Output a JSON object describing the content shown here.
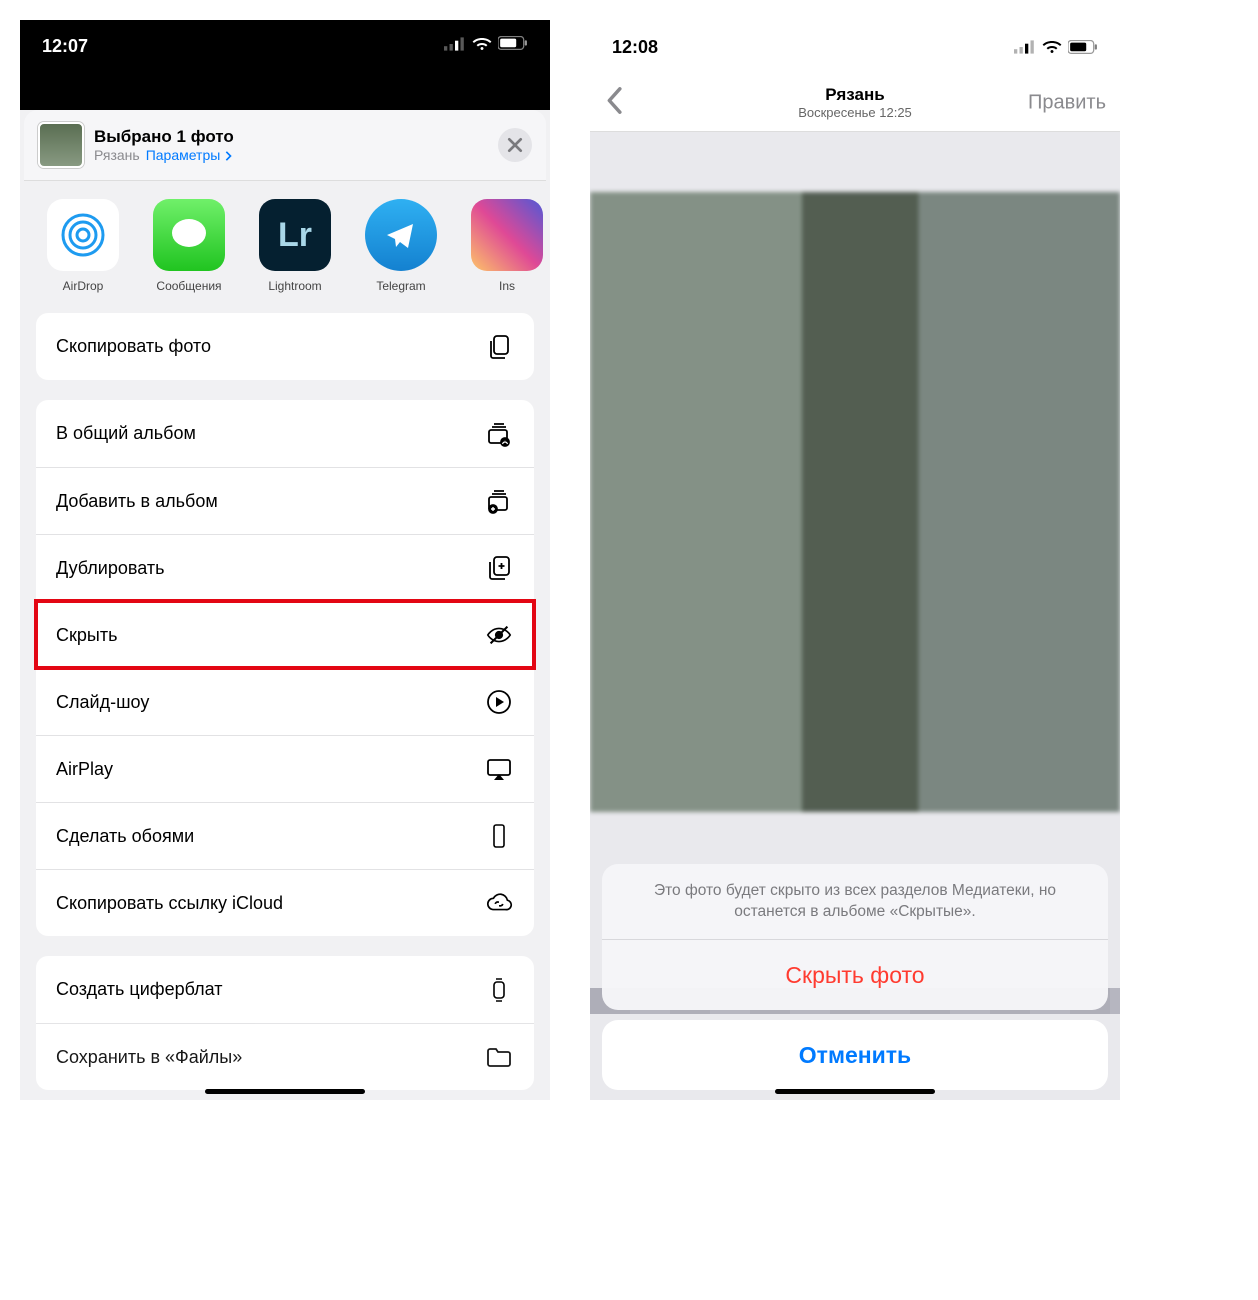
{
  "phone1": {
    "time": "12:07",
    "header": {
      "title": "Выбрано 1 фото",
      "location": "Рязань",
      "options": "Параметры"
    },
    "apps": [
      {
        "name": "AirDrop"
      },
      {
        "name": "Сообщения"
      },
      {
        "name": "Lightroom"
      },
      {
        "name": "Telegram"
      },
      {
        "name": "Ins"
      }
    ],
    "group1": [
      {
        "label": "Скопировать фото",
        "icon": "copy"
      }
    ],
    "group2": [
      {
        "label": "В общий альбом",
        "icon": "shared-album"
      },
      {
        "label": "Добавить в альбом",
        "icon": "add-album"
      },
      {
        "label": "Дублировать",
        "icon": "duplicate"
      },
      {
        "label": "Скрыть",
        "icon": "hide",
        "highlight": true
      },
      {
        "label": "Слайд-шоу",
        "icon": "play"
      },
      {
        "label": "AirPlay",
        "icon": "airplay"
      },
      {
        "label": "Сделать обоями",
        "icon": "wallpaper"
      },
      {
        "label": "Скопировать ссылку iCloud",
        "icon": "link"
      }
    ],
    "group3": [
      {
        "label": "Создать циферблат",
        "icon": "watch"
      },
      {
        "label": "Сохранить в «Файлы»",
        "icon": "folder"
      }
    ]
  },
  "phone2": {
    "time": "12:08",
    "nav": {
      "title": "Рязань",
      "subtitle": "Воскресенье 12:25",
      "edit": "Править"
    },
    "alert": {
      "message": "Это фото будет скрыто из всех разделов Медиатеки, но останется в альбоме «Скрытые».",
      "hide": "Скрыть фото",
      "cancel": "Отменить"
    }
  }
}
